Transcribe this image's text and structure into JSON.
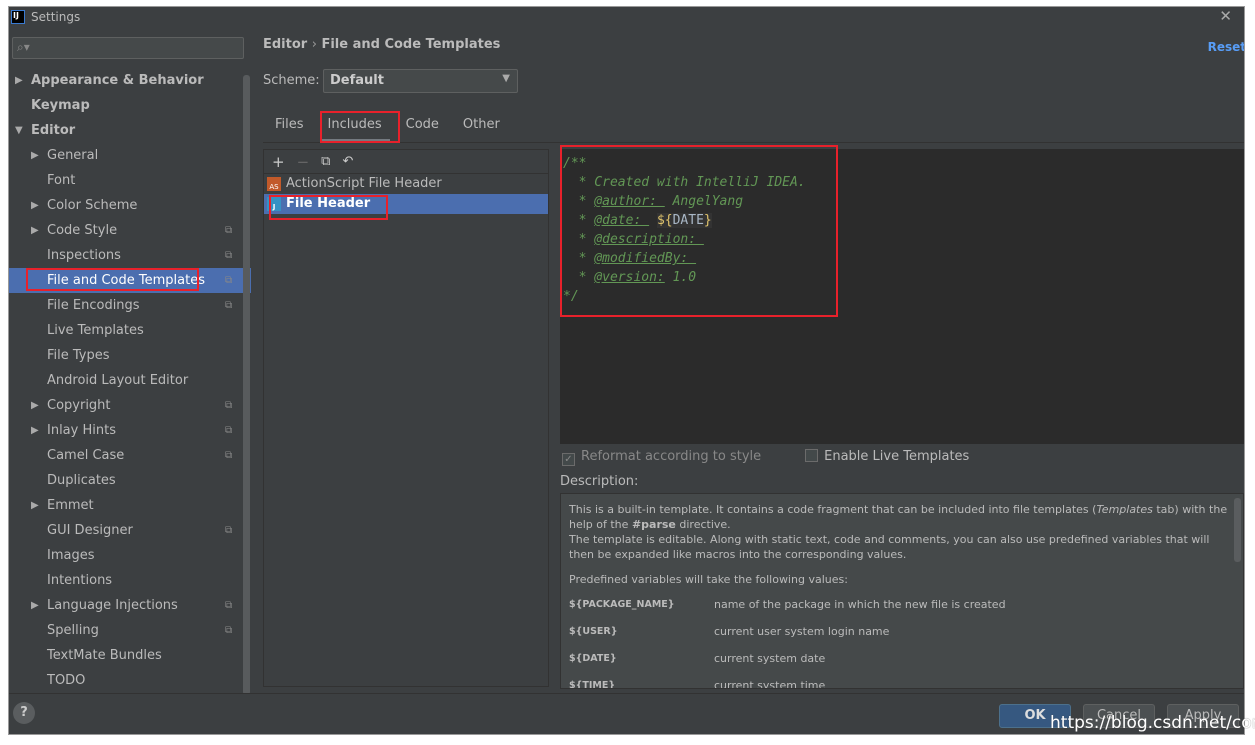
{
  "window": {
    "title": "Settings"
  },
  "sidebar": {
    "search_placeholder": "",
    "items": [
      {
        "label": "Appearance & Behavior",
        "level": 0,
        "arrow": "right",
        "bold": true
      },
      {
        "label": "Keymap",
        "level": 0,
        "bold": true
      },
      {
        "label": "Editor",
        "level": 0,
        "arrow": "down",
        "bold": true
      },
      {
        "label": "General",
        "level": 1,
        "arrow": "right"
      },
      {
        "label": "Font",
        "level": 1
      },
      {
        "label": "Color Scheme",
        "level": 1,
        "arrow": "right"
      },
      {
        "label": "Code Style",
        "level": 1,
        "arrow": "right",
        "copy": true
      },
      {
        "label": "Inspections",
        "level": 1,
        "copy": true
      },
      {
        "label": "File and Code Templates",
        "level": 1,
        "copy": true,
        "selected": true
      },
      {
        "label": "File Encodings",
        "level": 1,
        "copy": true
      },
      {
        "label": "Live Templates",
        "level": 1
      },
      {
        "label": "File Types",
        "level": 1
      },
      {
        "label": "Android Layout Editor",
        "level": 1
      },
      {
        "label": "Copyright",
        "level": 1,
        "arrow": "right",
        "copy": true
      },
      {
        "label": "Inlay Hints",
        "level": 1,
        "arrow": "right",
        "copy": true
      },
      {
        "label": "Camel Case",
        "level": 1,
        "copy": true
      },
      {
        "label": "Duplicates",
        "level": 1
      },
      {
        "label": "Emmet",
        "level": 1,
        "arrow": "right"
      },
      {
        "label": "GUI Designer",
        "level": 1,
        "copy": true
      },
      {
        "label": "Images",
        "level": 1
      },
      {
        "label": "Intentions",
        "level": 1
      },
      {
        "label": "Language Injections",
        "level": 1,
        "arrow": "right",
        "copy": true
      },
      {
        "label": "Spelling",
        "level": 1,
        "copy": true
      },
      {
        "label": "TextMate Bundles",
        "level": 1
      },
      {
        "label": "TODO",
        "level": 1
      }
    ]
  },
  "main": {
    "breadcrumb": [
      "Editor",
      "File and Code Templates"
    ],
    "reset": "Reset",
    "scheme_label": "Scheme:",
    "scheme_value": "Default",
    "tabs": [
      "Files",
      "Includes",
      "Code",
      "Other"
    ],
    "templates": [
      {
        "label": "ActionScript File Header",
        "icon": "AS"
      },
      {
        "label": "File Header",
        "icon": "J",
        "selected": true
      }
    ],
    "code": {
      "l0": "/**",
      "l1": "  * Created with IntelliJ IDEA.",
      "author_tag": "@author: ",
      "author_val": " AngelYang",
      "date_tag": "@date: ",
      "date_var": "DATE",
      "desc_tag": "@description: ",
      "mod_tag": "@modifiedBy: ",
      "ver_tag": "@version:",
      "ver_val": " 1.0",
      "end": "*/"
    },
    "reformat": "Reformat according to style",
    "live": "Enable Live Templates",
    "description_label": "Description:",
    "description": {
      "p1a": "This is a built-in template. It contains a code fragment that can be included into file templates (",
      "p1i": "Templates",
      "p1b": " tab) with the help of the ",
      "p1parse": "#parse",
      "p1c": " directive.",
      "p2": "The template is editable. Along with static text, code and comments, you can also use predefined variables that will then be expanded like macros into the corresponding values.",
      "p3": "Predefined variables will take the following values:",
      "vars": [
        {
          "name": "${PACKAGE_NAME}",
          "desc": "name of the package in which the new file is created"
        },
        {
          "name": "${USER}",
          "desc": "current user system login name"
        },
        {
          "name": "${DATE}",
          "desc": "current system date"
        },
        {
          "name": "${TIME}",
          "desc": "current system time"
        }
      ]
    }
  },
  "footer": {
    "help": "?",
    "ok": "OK",
    "cancel": "Cancel",
    "apply": "Apply"
  },
  "watermark": "https://blog.csdn.net/const",
  "colors": {
    "selection": "#4b6eaf",
    "highlight": "#e8212b",
    "doc_comment": "#629755"
  }
}
